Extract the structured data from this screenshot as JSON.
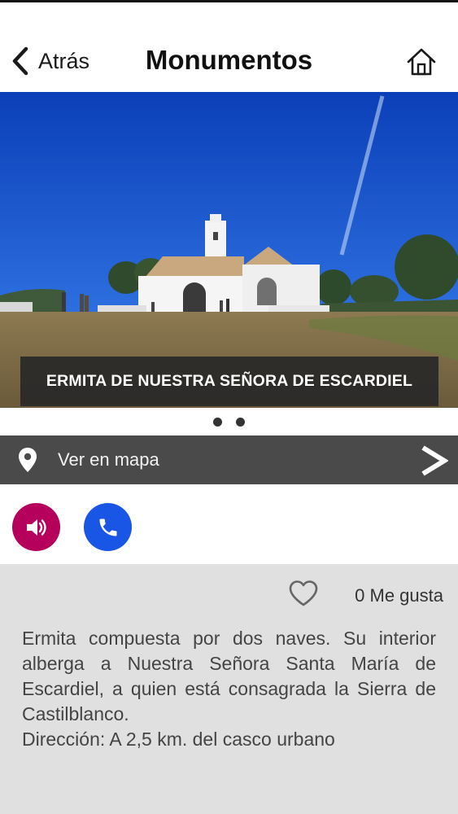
{
  "header": {
    "back_label": "Atrás",
    "title": "Monumentos",
    "home_icon": "home-icon"
  },
  "hero": {
    "caption": "ERMITA DE NUESTRA SEÑORA DE ESCARDIEL",
    "slides_count": 2
  },
  "map_bar": {
    "label": "Ver en mapa",
    "icon": "location-pin-icon"
  },
  "actions": {
    "audio_color": "#b5005c",
    "phone_color": "#1a56e6"
  },
  "likes": {
    "label": "0 Me gusta"
  },
  "description": {
    "text": "Ermita compuesta por dos naves. Su interior alberga a Nuestra Señora Santa María de Escardiel, a quien está consagrada la Sierra de Castilblanco.",
    "address": "Dirección: A 2,5 km. del casco urbano"
  }
}
